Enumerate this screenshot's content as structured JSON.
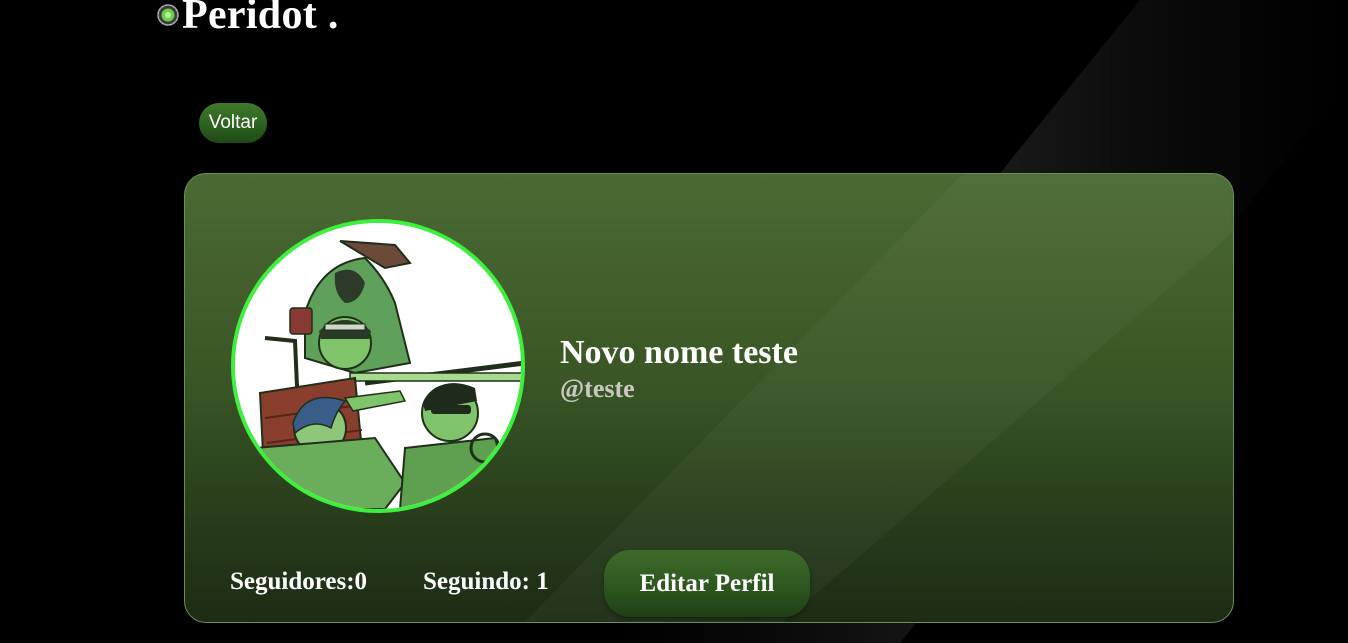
{
  "header": {
    "logo_icon": "peridot-gem-icon",
    "title": "Peridot ."
  },
  "nav": {
    "back_label": "Voltar"
  },
  "profile": {
    "avatar_icon": "profile-avatar-image",
    "display_name": "Novo nome teste",
    "username": "@teste",
    "followers_text": "Seguidores:0",
    "following_text": "Seguindo: 1",
    "edit_label": "Editar Perfil"
  },
  "colors": {
    "background": "#000000",
    "card_top": "#4b6a33",
    "card_bottom": "#1d2c15",
    "avatar_border": "#3df03d",
    "button_green": "#2e6220",
    "username_gray": "#c9c9c0"
  }
}
